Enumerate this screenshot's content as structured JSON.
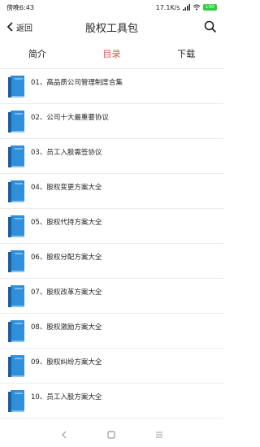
{
  "status_bar": {
    "time": "傍晚6:43",
    "network": "17.1K/s",
    "battery": "100"
  },
  "header": {
    "back_label": "返回",
    "title": "股权工具包"
  },
  "tabs": [
    {
      "label": "简介",
      "active": false
    },
    {
      "label": "目录",
      "active": true
    },
    {
      "label": "下载",
      "active": false
    }
  ],
  "items": [
    {
      "label": "01、高品质公司管理制度合集"
    },
    {
      "label": "02、公司十大最重要协议"
    },
    {
      "label": "03、员工入股需签协议"
    },
    {
      "label": "04、股权变更方案大全"
    },
    {
      "label": "05、股权代持方案大全"
    },
    {
      "label": "06、股权分配方案大全"
    },
    {
      "label": "07、股权改革方案大全"
    },
    {
      "label": "08、股权激励方案大全"
    },
    {
      "label": "09、股权纠纷方案大全"
    },
    {
      "label": "10、员工入股方案大全"
    }
  ],
  "colors": {
    "accent": "#d9534f",
    "book_blue": "#2f8fd8"
  }
}
